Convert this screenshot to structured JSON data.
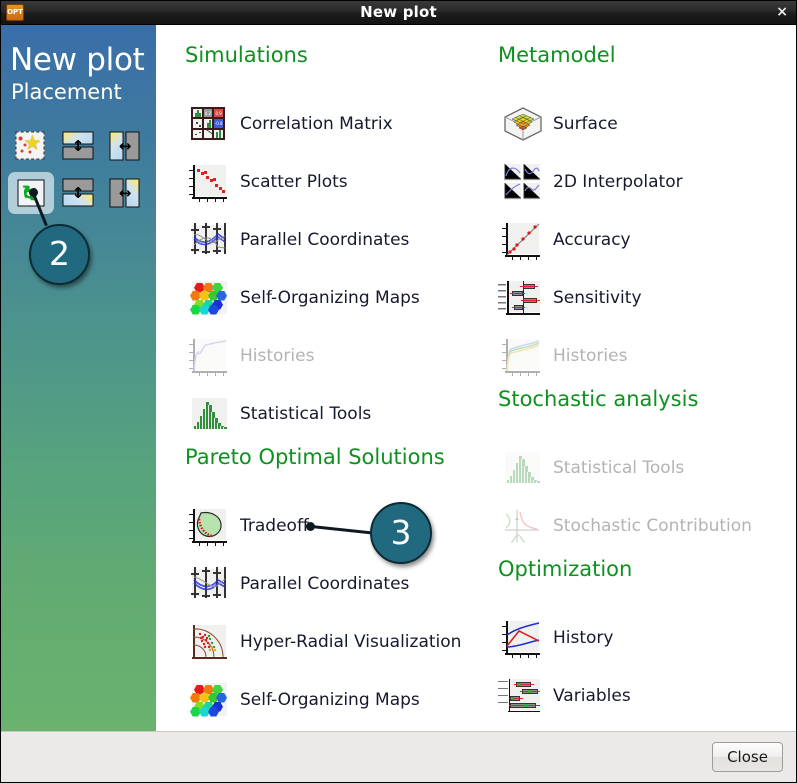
{
  "window": {
    "title": "New plot",
    "app_icon": "opt-app-icon",
    "close_glyph": "×"
  },
  "sidebar": {
    "title": "New plot",
    "subtitle": "Placement",
    "gradient_top": "#3a6ea8",
    "gradient_bottom": "#6ab26e",
    "placement_options": [
      {
        "name": "new-window",
        "icon": "new-window-icon",
        "selected": false
      },
      {
        "name": "split-below",
        "icon": "split-below-icon",
        "selected": false
      },
      {
        "name": "split-right",
        "icon": "split-right-icon",
        "selected": false
      },
      {
        "name": "replace",
        "icon": "replace-icon",
        "selected": true
      },
      {
        "name": "split-above",
        "icon": "split-above-icon",
        "selected": false
      },
      {
        "name": "split-left",
        "icon": "split-left-icon",
        "selected": false
      }
    ]
  },
  "annotations": [
    {
      "label": "2",
      "target": "replace-placement-button"
    },
    {
      "label": "3",
      "target": "tradeoff-item"
    }
  ],
  "colors": {
    "section_heading": "#0f9020",
    "item_label": "#161a2e",
    "item_label_disabled": "#b3b3b3",
    "annotation_bubble": "#21697f",
    "main_background": "#ffffff",
    "bottom_bar": "#eceae8"
  },
  "main": {
    "left_column": [
      {
        "heading": "Simulations",
        "items": [
          {
            "label": "Correlation Matrix",
            "icon": "correlation-matrix-icon",
            "enabled": true
          },
          {
            "label": "Scatter Plots",
            "icon": "scatter-plots-icon",
            "enabled": true
          },
          {
            "label": "Parallel Coordinates",
            "icon": "parallel-coordinates-icon",
            "enabled": true
          },
          {
            "label": "Self-Organizing Maps",
            "icon": "self-organizing-maps-icon",
            "enabled": true
          },
          {
            "label": "Histories",
            "icon": "histories-icon",
            "enabled": false
          },
          {
            "label": "Statistical Tools",
            "icon": "statistical-tools-icon",
            "enabled": true
          }
        ]
      },
      {
        "heading": "Pareto Optimal Solutions",
        "items": [
          {
            "label": "Tradeoff",
            "icon": "tradeoff-icon",
            "enabled": true
          },
          {
            "label": "Parallel Coordinates",
            "icon": "parallel-coordinates-icon",
            "enabled": true
          },
          {
            "label": "Hyper-Radial Visualization",
            "icon": "hyper-radial-icon",
            "enabled": true
          },
          {
            "label": "Self-Organizing Maps",
            "icon": "self-organizing-maps-icon",
            "enabled": true
          }
        ]
      }
    ],
    "right_column": [
      {
        "heading": "Metamodel",
        "items": [
          {
            "label": "Surface",
            "icon": "surface-icon",
            "enabled": true
          },
          {
            "label": "2D Interpolator",
            "icon": "interpolator-2d-icon",
            "enabled": true
          },
          {
            "label": "Accuracy",
            "icon": "accuracy-icon",
            "enabled": true
          },
          {
            "label": "Sensitivity",
            "icon": "sensitivity-icon",
            "enabled": true
          },
          {
            "label": "Histories",
            "icon": "histories-icon",
            "enabled": false
          }
        ]
      },
      {
        "heading": "Stochastic analysis",
        "items": [
          {
            "label": "Statistical Tools",
            "icon": "statistical-tools-icon",
            "enabled": false
          },
          {
            "label": "Stochastic Contribution",
            "icon": "stochastic-contribution-icon",
            "enabled": false
          }
        ]
      },
      {
        "heading": "Optimization",
        "items": [
          {
            "label": "History",
            "icon": "optimization-history-icon",
            "enabled": true
          },
          {
            "label": "Variables",
            "icon": "optimization-variables-icon",
            "enabled": true
          }
        ]
      }
    ]
  },
  "footer": {
    "close_label": "Close"
  }
}
